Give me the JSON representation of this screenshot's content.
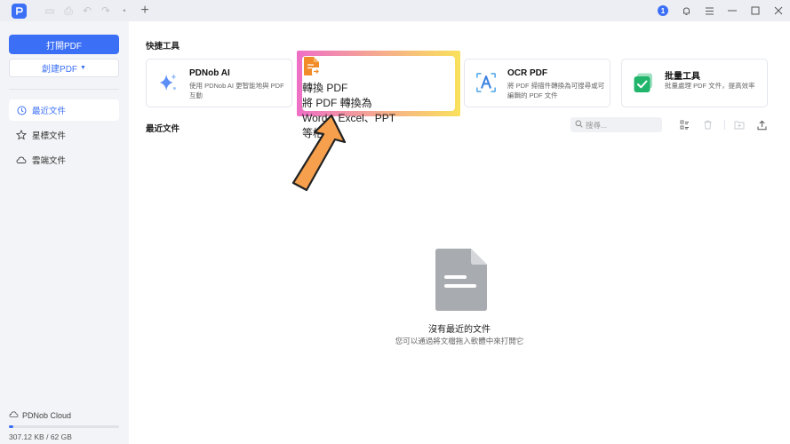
{
  "sidebar": {
    "open_pdf": "打開PDF",
    "create_pdf": "創建PDF",
    "nav": [
      {
        "label": "最近文件",
        "icon": "clock-icon",
        "active": true
      },
      {
        "label": "星標文件",
        "icon": "star-icon",
        "active": false
      },
      {
        "label": "雲端文件",
        "icon": "cloud-icon",
        "active": false
      }
    ],
    "cloud_label": "PDNob Cloud",
    "storage_used": "307.12 KB",
    "storage_sep": "/",
    "storage_total": "62 GB"
  },
  "titlebar": {
    "notification_count": "1"
  },
  "main": {
    "quick_tools_title": "快捷工具",
    "tools": [
      {
        "name": "PDNob AI",
        "desc": "使用 PDNob AI 更智能地與 PDF 互動",
        "icon": "sparkle-icon"
      },
      {
        "name": "轉換 PDF",
        "desc": "將 PDF 轉換為 Word、Excel、PPT 等格式",
        "icon": "convert-icon"
      },
      {
        "name": "OCR PDF",
        "desc": "將 PDF 掃描件轉換為可搜尋或可編輯的 PDF 文件",
        "icon": "ocr-icon"
      },
      {
        "name": "批量工具",
        "desc": "批量處理 PDF 文件，提高效率",
        "icon": "batch-icon"
      }
    ],
    "recent_title": "最近文件",
    "search_placeholder": "搜尋...",
    "empty_title": "沒有最近的文件",
    "empty_subtitle": "您可以通過將文檔拖入軟體中來打開它"
  },
  "colors": {
    "accent": "#3b6ff5",
    "highlight_start": "#ee6fc7",
    "highlight_end": "#f9e15b",
    "arrow": "#f6a04d"
  }
}
